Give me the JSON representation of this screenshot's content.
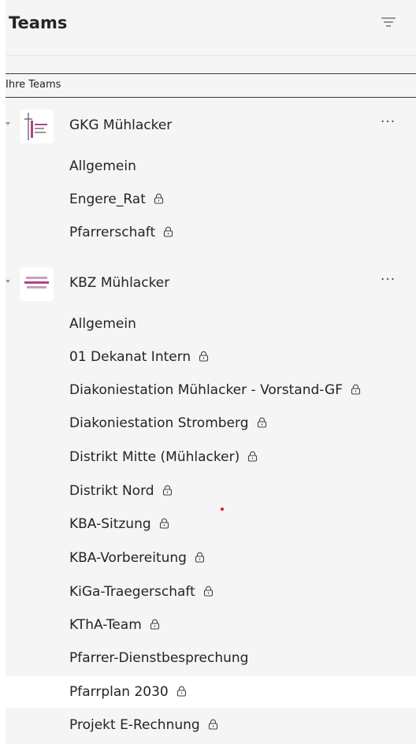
{
  "header": {
    "title": "Teams"
  },
  "section": {
    "label": "Ihre Teams"
  },
  "teams": [
    {
      "name": "GKG Mühlacker",
      "more": "···",
      "channels": [
        {
          "label": "Allgemein",
          "private": false
        },
        {
          "label": "Engere_Rat",
          "private": true
        },
        {
          "label": "Pfarrerschaft",
          "private": true
        }
      ]
    },
    {
      "name": "KBZ Mühlacker",
      "more": "···",
      "channels": [
        {
          "label": "Allgemein",
          "private": false
        },
        {
          "label": "01 Dekanat Intern",
          "private": true
        },
        {
          "label": "Diakoniestation Mühlacker - Vorstand-GF",
          "private": true
        },
        {
          "label": "Diakoniestation Stromberg",
          "private": true
        },
        {
          "label": "Distrikt Mitte (Mühlacker)",
          "private": true
        },
        {
          "label": "Distrikt Nord",
          "private": true
        },
        {
          "label": "KBA-Sitzung",
          "private": true
        },
        {
          "label": "KBA-Vorbereitung",
          "private": true
        },
        {
          "label": "KiGa-Traegerschaft",
          "private": true
        },
        {
          "label": "KThA-Team",
          "private": true
        },
        {
          "label": "Pfarrer-Dienstbesprechung",
          "private": false
        },
        {
          "label": "Pfarrplan 2030",
          "private": true,
          "selected": true
        },
        {
          "label": "Projekt E-Rechnung",
          "private": true
        }
      ]
    }
  ],
  "colors": {
    "selected_bg": "#ffffff",
    "panel_bg": "#f5f5f5",
    "badge_dot": "#e81123",
    "avatar_accent": "#b0418f"
  },
  "icons": {
    "filter": "filter-icon",
    "lock": "lock-icon",
    "more": "more-options-icon"
  }
}
